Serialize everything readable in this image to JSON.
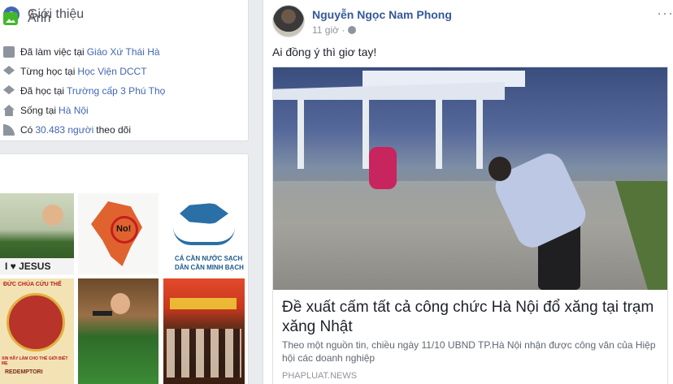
{
  "intro": {
    "title": "Giới thiệu",
    "items": [
      {
        "icon": "briefcase-icon",
        "prefix": "Đã làm việc tại",
        "link": "Giáo Xứ Thái Hà",
        "suffix": ""
      },
      {
        "icon": "graduation-cap-icon",
        "prefix": "Từng học tại",
        "link": "Học Viện DCCT",
        "suffix": ""
      },
      {
        "icon": "graduation-cap-icon",
        "prefix": "Đã học tại",
        "link": "Trường cấp 3 Phú Thọ",
        "suffix": ""
      },
      {
        "icon": "home-icon",
        "prefix": "Sống tại",
        "link": "Hà Nội",
        "suffix": ""
      },
      {
        "icon": "rss-icon",
        "prefix": "Có",
        "link": "30.483 người",
        "suffix": "theo dõi"
      }
    ]
  },
  "photos": {
    "title": "Ảnh",
    "thumb_texts": {
      "t1": "I ♥ JESUS",
      "t2": "No!",
      "t3_line1": "CÁ CẦN NƯỚC SẠCH",
      "t3_line2": "DÂN CẦN MINH BẠCH",
      "t4_top": "ĐỨC CHÚA CỨU THẾ",
      "t4_bottom": "XIN HÃY LÀM CHO THẾ GIỚI BIẾT MẸ",
      "t4_foot": "REDEMPTORI"
    }
  },
  "post": {
    "author": "Nguyễn Ngọc Nam Phong",
    "time": "11 giờ ·",
    "text": "Ai đồng ý thì giơ tay!",
    "link": {
      "title": "Đề xuất cấm tất cả công chức Hà Nội đổ xăng tại trạm xăng Nhật",
      "description": "Theo một nguồn tin, chiều ngày 11/10 UBND TP.Hà Nội nhận được công văn của Hiệp hội các doanh nghiệp",
      "source": "PHAPLUAT.NEWS"
    }
  },
  "colors": {
    "link": "#4267b2",
    "author": "#365899",
    "muted": "#90949c",
    "background": "#e9ebee"
  }
}
